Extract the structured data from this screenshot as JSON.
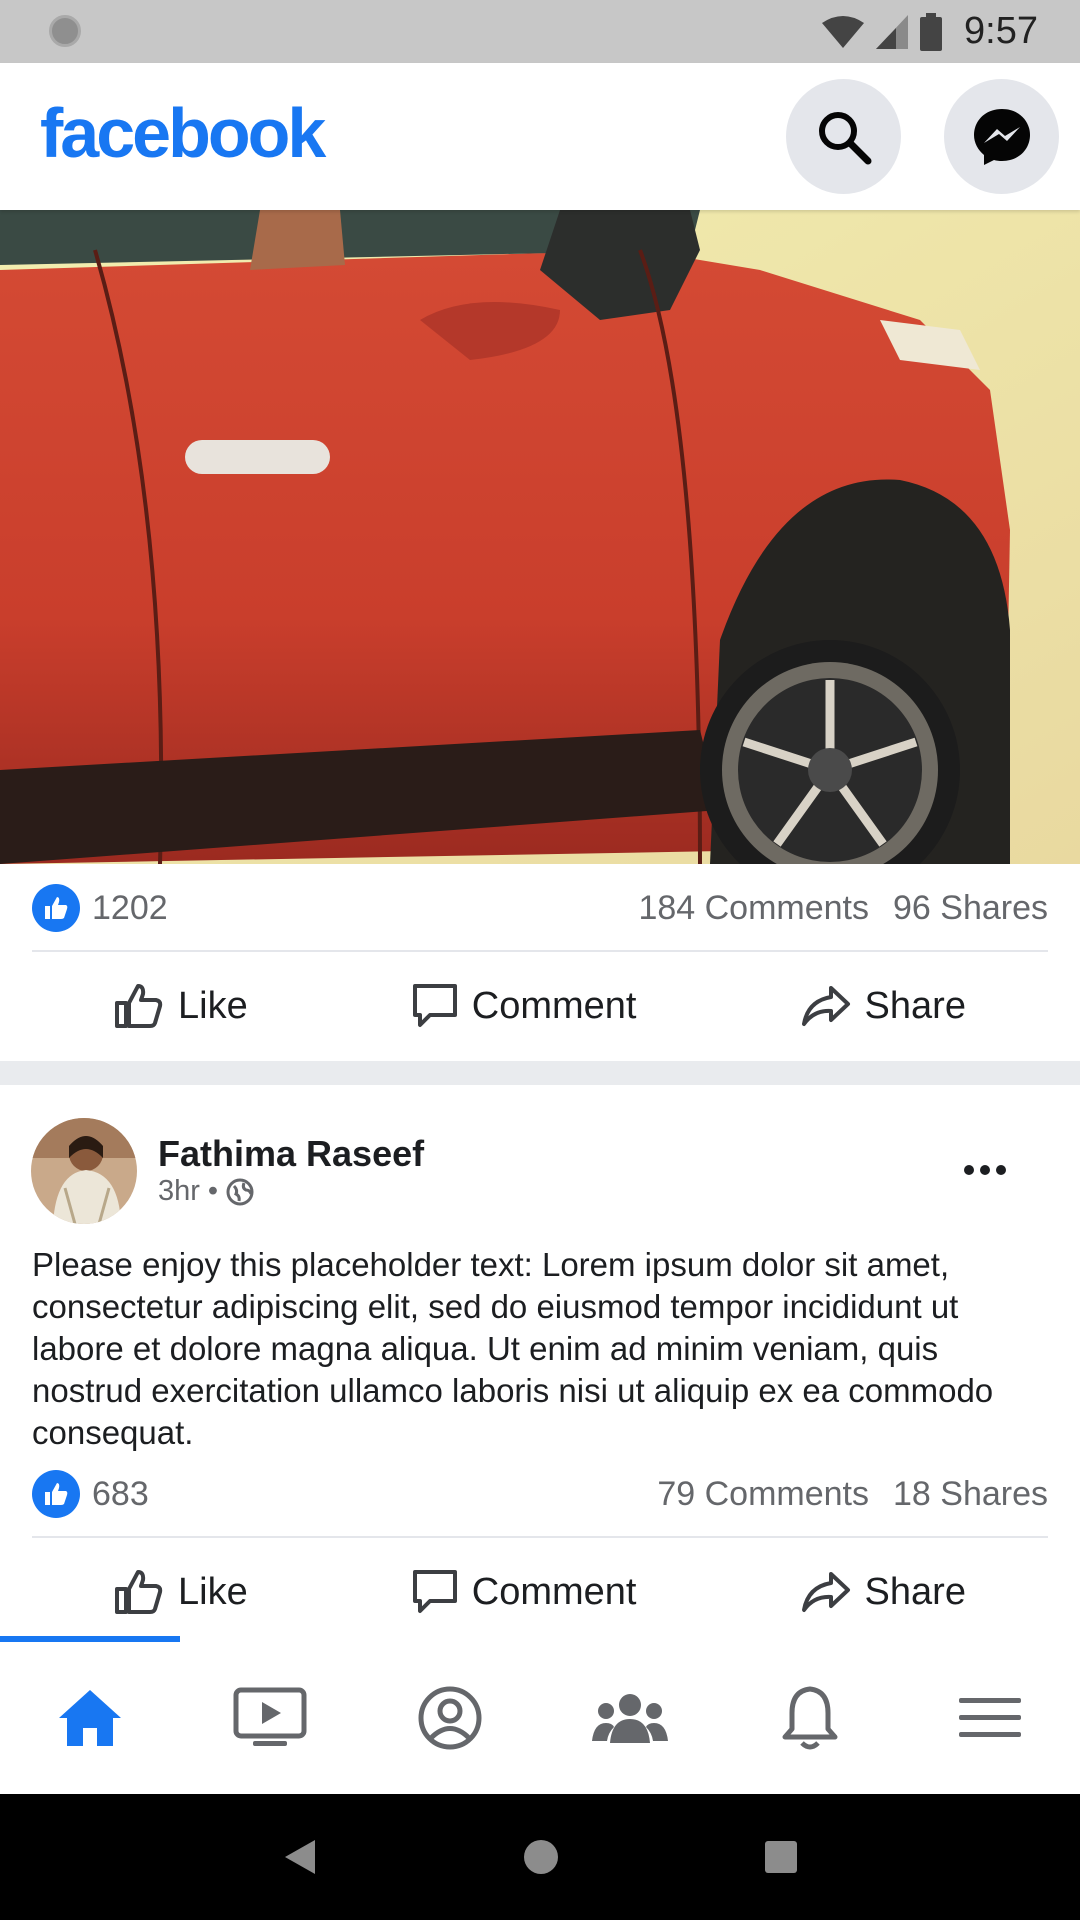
{
  "status_bar": {
    "time": "9:57"
  },
  "header": {
    "logo": "facebook"
  },
  "posts": [
    {
      "likes": "1202",
      "comments": "184 Comments",
      "shares": "96 Shares",
      "actions": {
        "like": "Like",
        "comment": "Comment",
        "share": "Share"
      }
    },
    {
      "author": "Fathima Raseef",
      "time": "3hr",
      "separator": "•",
      "text": "Please enjoy this placeholder text: Lorem ipsum dolor sit amet, consectetur adipiscing elit, sed do eiusmod tempor incididunt ut labore et dolore magna aliqua. Ut enim ad minim veniam, quis nostrud exercitation ullamco laboris nisi ut aliquip ex ea commodo consequat.",
      "likes": "683",
      "comments": "79 Comments",
      "shares": "18 Shares",
      "actions": {
        "like": "Like",
        "comment": "Comment",
        "share": "Share"
      }
    }
  ],
  "icons": {
    "header": [
      "search-icon",
      "messenger-icon"
    ],
    "bottom_nav": [
      "home-icon",
      "watch-icon",
      "profile-icon",
      "groups-icon",
      "notifications-icon",
      "menu-icon"
    ]
  },
  "colors": {
    "brand": "#1877f2",
    "status_bar": "#c7c7c7",
    "separator": "#e9ebee",
    "secondary_text": "#65676b"
  }
}
